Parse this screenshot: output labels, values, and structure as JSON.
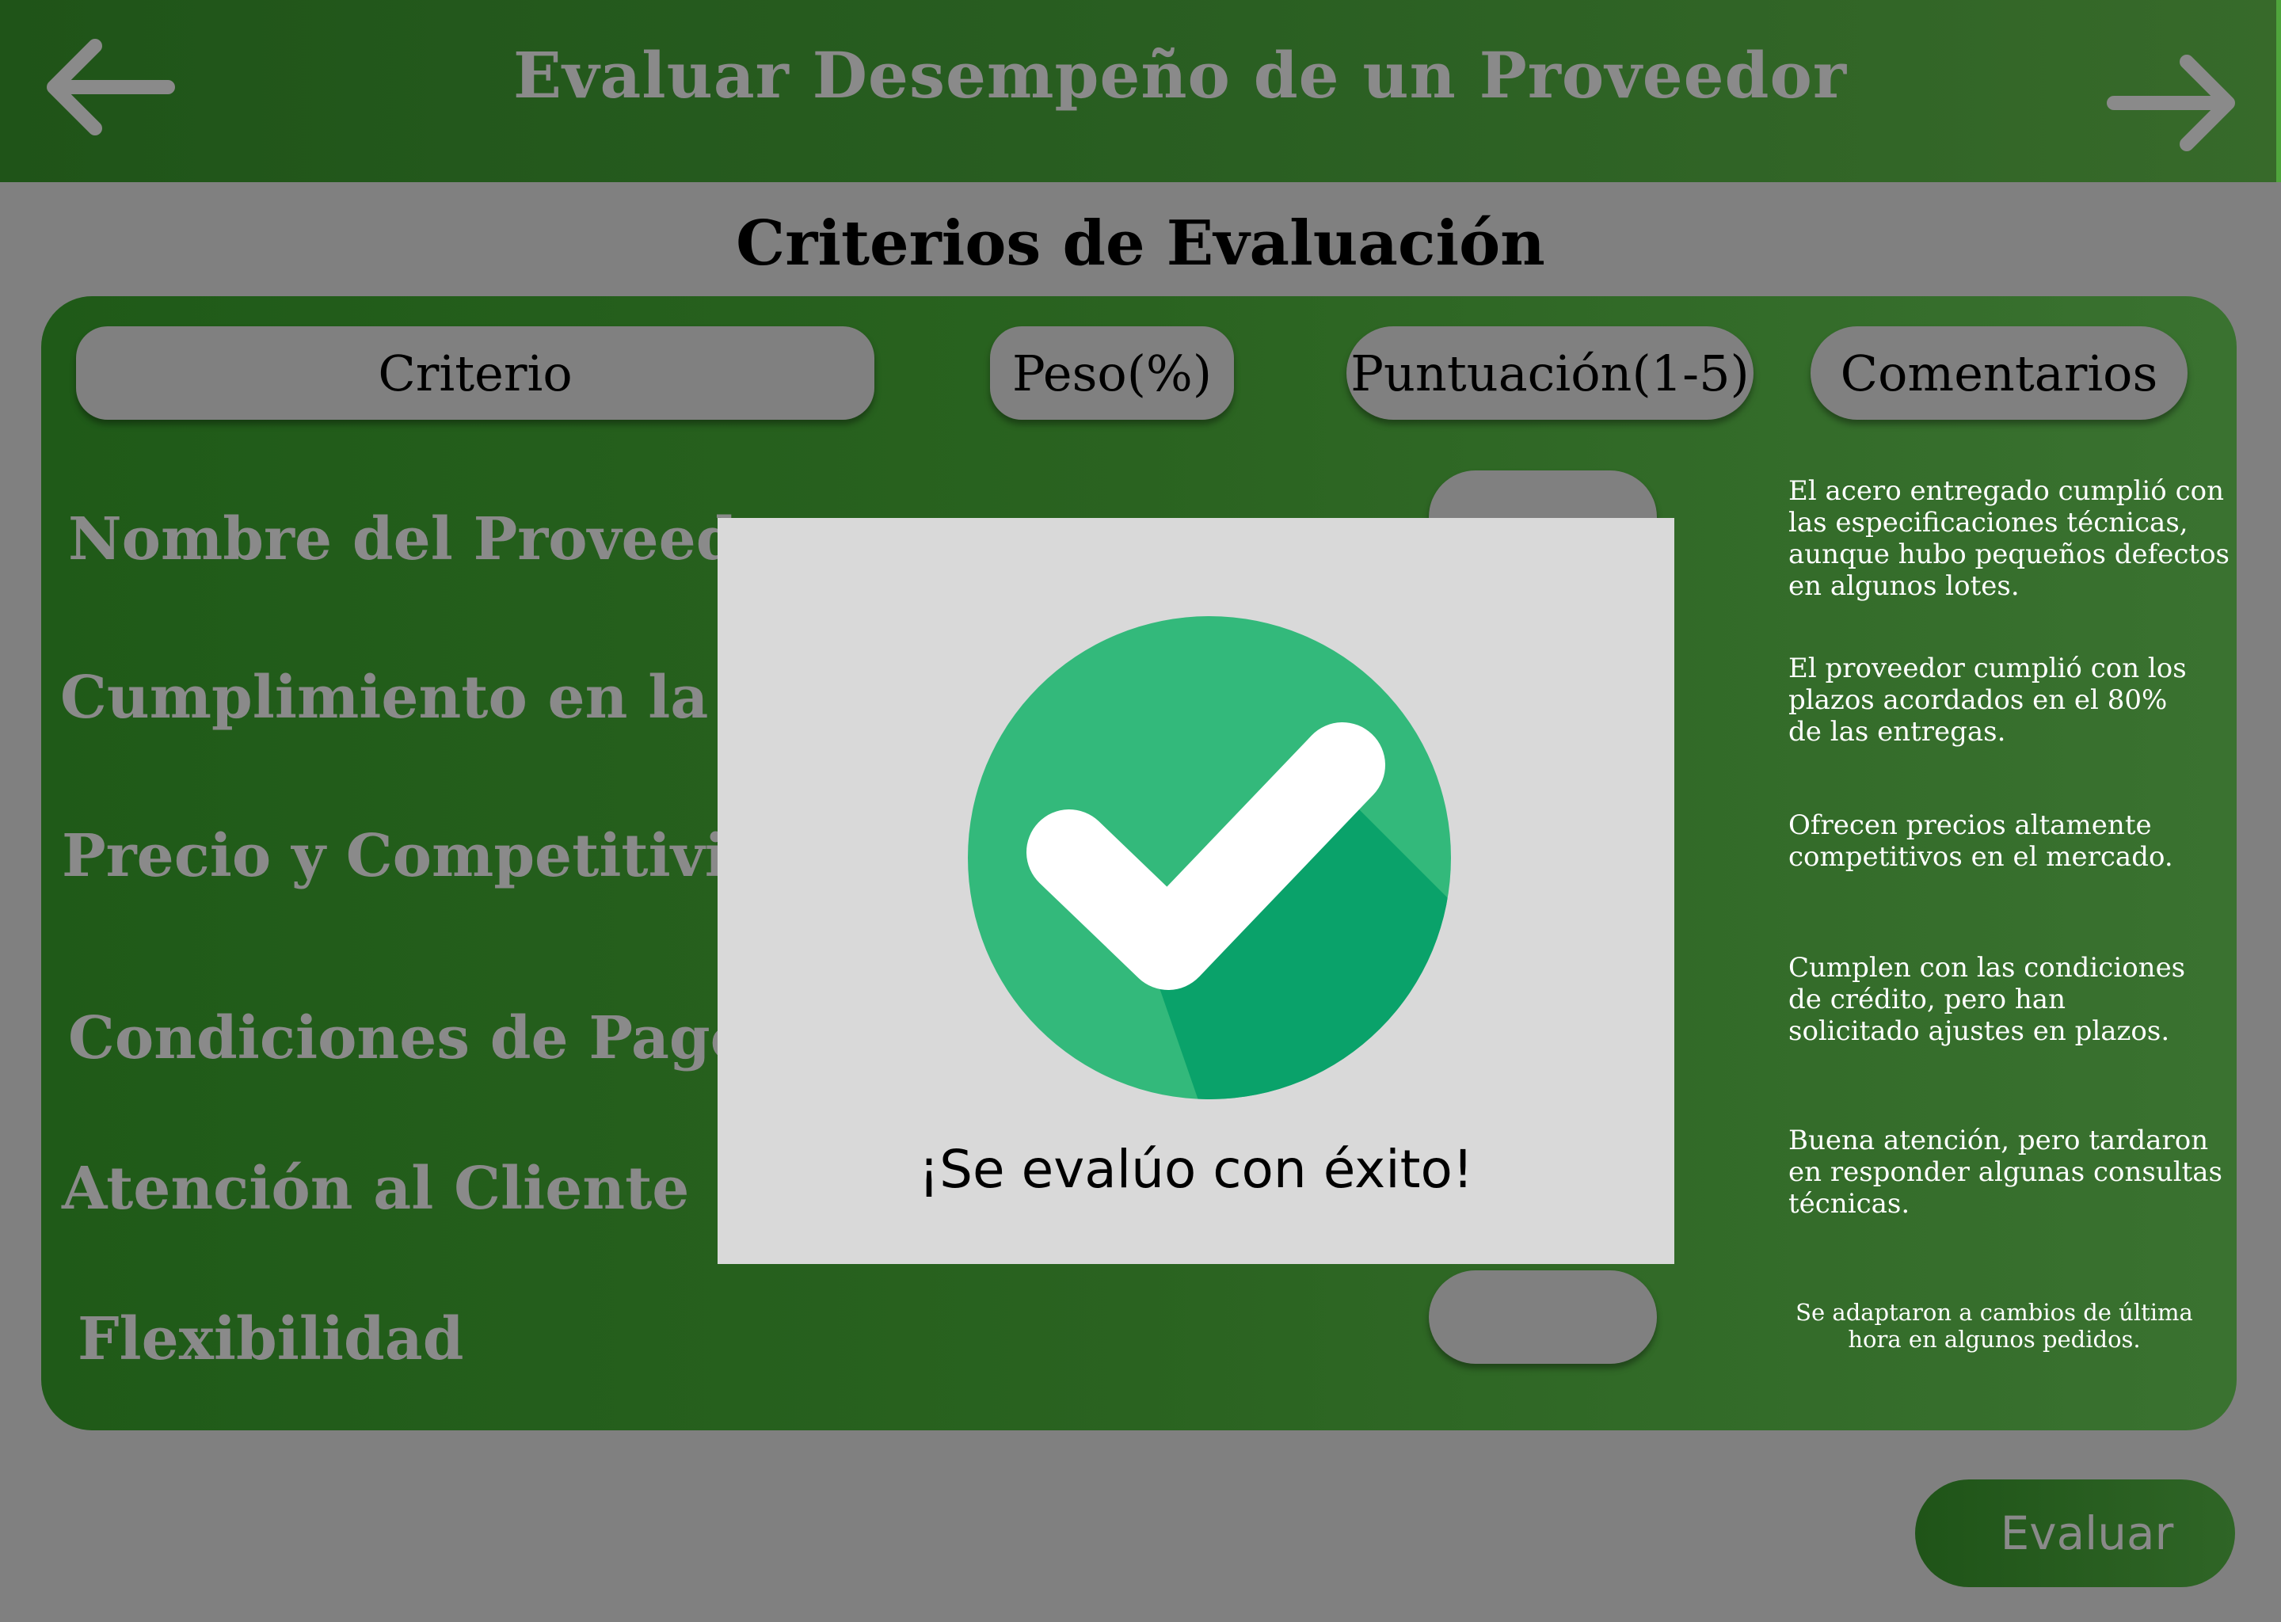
{
  "header": {
    "title": "Evaluar Desempeño de un Proveedor",
    "back_icon": "arrow-left-icon",
    "next_icon": "arrow-right-icon"
  },
  "section_title": "Criterios de Evaluación",
  "columns": {
    "criterio": "Criterio",
    "peso": "Peso(%)",
    "puntuacion": "Puntuación(1-5)",
    "comentarios": "Comentarios"
  },
  "criteria": [
    "Nombre del Proveedor",
    "Cumplimiento en la En",
    "Precio y Competitivida",
    "Condiciones de Pago",
    "Atención al Cliente",
    "Flexibilidad"
  ],
  "comments": [
    "El acero entregado cumplió con las especificaciones técnicas, aunque hubo pequeños defectos en algunos lotes.",
    "El proveedor cumplió con los plazos acordados en el 80% de las entregas.",
    "Ofrecen precios altamente competitivos en el mercado.",
    "Cumplen con las condiciones de crédito, pero han solicitado ajustes en plazos.",
    "Buena atención, pero tardaron en responder algunas consultas técnicas.",
    "Se adaptaron a cambios de última hora en algunos pedidos."
  ],
  "modal": {
    "icon": "check-circle-icon",
    "message": "¡Se evalúo con éxito!"
  },
  "evaluate_button": "Evaluar",
  "colors": {
    "header_green": "#1f5418",
    "success_green": "#33b97b",
    "success_shadow": "#0aa26a",
    "overlay_gray": "#808080",
    "modal_bg": "#d9d9d9"
  }
}
